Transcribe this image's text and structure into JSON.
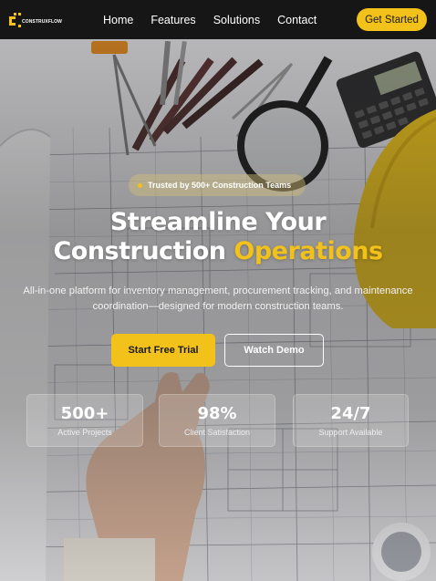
{
  "nav": {
    "logo_text": "CONSTRUXFLOW",
    "links": [
      "Home",
      "Features",
      "Solutions",
      "Contact"
    ],
    "cta_label": "Get Started"
  },
  "hero": {
    "badge": "Trusted by 500+ Construction Teams",
    "title_line1": "Streamline Your",
    "title_line2_plain": "Construction ",
    "title_line2_accent": "Operations",
    "subtitle": "All-in-one platform for inventory management, procurement tracking, and maintenance coordination—designed for modern construction teams.",
    "primary_cta": "Start Free Trial",
    "secondary_cta": "Watch Demo"
  },
  "stats": [
    {
      "value": "500+",
      "label": "Active Projects"
    },
    {
      "value": "98%",
      "label": "Client Satisfaction"
    },
    {
      "value": "24/7",
      "label": "Support Available"
    }
  ],
  "colors": {
    "accent": "#f2c11a",
    "nav_bg": "#161616",
    "text_light": "#ffffff"
  },
  "background_image": "construction blueprint desk with drafting tools, magnifier, calculator, hard hat and hand"
}
